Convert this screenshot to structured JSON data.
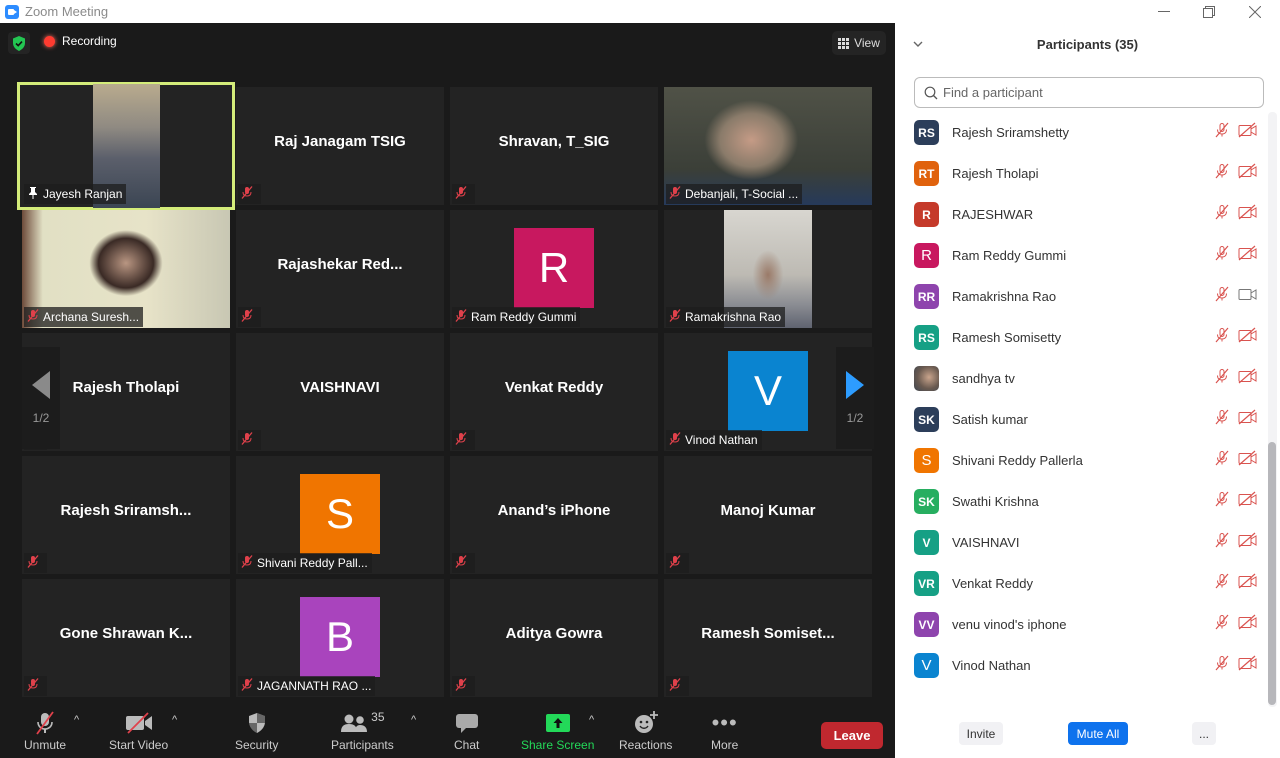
{
  "window": {
    "title": "Zoom Meeting"
  },
  "top_bar": {
    "recording_label": "Recording",
    "view_label": "View"
  },
  "gallery": {
    "page_indicator": "1/2",
    "tiles": [
      {
        "name": "Jayesh Ranjan",
        "display": "video",
        "active_speaker": true,
        "pinned": true,
        "muted": false
      },
      {
        "name": "Raj Janagam TSIG",
        "display": "name",
        "muted": true
      },
      {
        "name": "Shravan, T_SIG",
        "display": "name",
        "muted": true
      },
      {
        "name": "Debanjali, T-Social ...",
        "display": "video",
        "muted": true
      },
      {
        "name": "Archana Suresh...",
        "display": "video",
        "muted": true
      },
      {
        "name": "Rajashekar  Red...",
        "display": "name",
        "muted": true
      },
      {
        "name": "Ram Reddy Gummi",
        "display": "avatar",
        "avatar_letter": "R",
        "avatar_color": "#c8185f",
        "muted": true
      },
      {
        "name": "Ramakrishna Rao",
        "display": "video",
        "muted": true
      },
      {
        "name": "Rajesh Tholapi",
        "display": "name",
        "muted": true
      },
      {
        "name": "VAISHNAVI",
        "display": "name",
        "muted": true
      },
      {
        "name": "Venkat Reddy",
        "display": "name",
        "muted": true
      },
      {
        "name": "Vinod Nathan",
        "display": "avatar",
        "avatar_letter": "V",
        "avatar_color": "#0a84d0",
        "muted": true
      },
      {
        "name": "Rajesh  Sriramsh...",
        "display": "name",
        "muted": true
      },
      {
        "name": "Shivani Reddy Pall...",
        "display": "avatar",
        "avatar_letter": "S",
        "avatar_color": "#f07500",
        "muted": true
      },
      {
        "name": "Anand’s iPhone",
        "display": "name",
        "muted": true
      },
      {
        "name": "Manoj Kumar",
        "display": "name",
        "muted": true
      },
      {
        "name": "Gone  Shrawan  K...",
        "display": "name",
        "muted": true
      },
      {
        "name": "JAGANNATH RAO ...",
        "display": "avatar",
        "avatar_letter": "B",
        "avatar_color": "#a944bd",
        "muted": true
      },
      {
        "name": "Aditya Gowra",
        "display": "name",
        "muted": true
      },
      {
        "name": "Ramesh  Somiset...",
        "display": "name",
        "muted": true
      }
    ]
  },
  "toolbar": {
    "unmute_label": "Unmute",
    "start_video_label": "Start Video",
    "security_label": "Security",
    "participants_label": "Participants",
    "participants_count": "35",
    "chat_label": "Chat",
    "share_screen_label": "Share Screen",
    "reactions_label": "Reactions",
    "more_label": "More",
    "leave_label": "Leave",
    "share_color": "#23d959",
    "leave_color": "#c0282f"
  },
  "participants_panel": {
    "title": "Participants (35)",
    "search_placeholder": "Find a participant",
    "items": [
      {
        "initials": "RS",
        "name": "Rajesh Sriramshetty",
        "color": "#2c3e5a",
        "muted": true,
        "video_off": true
      },
      {
        "initials": "RT",
        "name": "Rajesh Tholapi",
        "color": "#e0620d",
        "muted": true,
        "video_off": true
      },
      {
        "initials": "R",
        "name": "RAJESHWAR",
        "color": "#c53a2a",
        "muted": true,
        "video_off": true
      },
      {
        "initials": "R",
        "name": "Ram Reddy Gummi",
        "color": "#c8185f",
        "muted": true,
        "video_off": true,
        "light": true
      },
      {
        "initials": "RR",
        "name": "Ramakrishna Rao",
        "color": "#8e44ad",
        "muted": true,
        "video_off": false
      },
      {
        "initials": "RS",
        "name": "Ramesh Somisetty",
        "color": "#16a085",
        "muted": true,
        "video_off": true
      },
      {
        "initials": "",
        "name": "sandhya tv",
        "color": "#8a7a6a",
        "photo": true,
        "muted": true,
        "video_off": true
      },
      {
        "initials": "SK",
        "name": "Satish kumar",
        "color": "#2c3e5a",
        "muted": true,
        "video_off": true
      },
      {
        "initials": "S",
        "name": "Shivani Reddy Pallerla",
        "color": "#f07500",
        "muted": true,
        "video_off": true,
        "light": true
      },
      {
        "initials": "SK",
        "name": "Swathi Krishna",
        "color": "#27ae60",
        "muted": true,
        "video_off": true
      },
      {
        "initials": "V",
        "name": "VAISHNAVI",
        "color": "#16a085",
        "muted": true,
        "video_off": true
      },
      {
        "initials": "VR",
        "name": "Venkat Reddy",
        "color": "#16a085",
        "muted": true,
        "video_off": true
      },
      {
        "initials": "VV",
        "name": "venu vinod's iphone",
        "color": "#8e44ad",
        "muted": true,
        "video_off": true
      },
      {
        "initials": "V",
        "name": "Vinod Nathan",
        "color": "#0a84d0",
        "muted": true,
        "video_off": true,
        "light": true
      }
    ],
    "invite_label": "Invite",
    "mute_all_label": "Mute All",
    "more_label": "..."
  }
}
